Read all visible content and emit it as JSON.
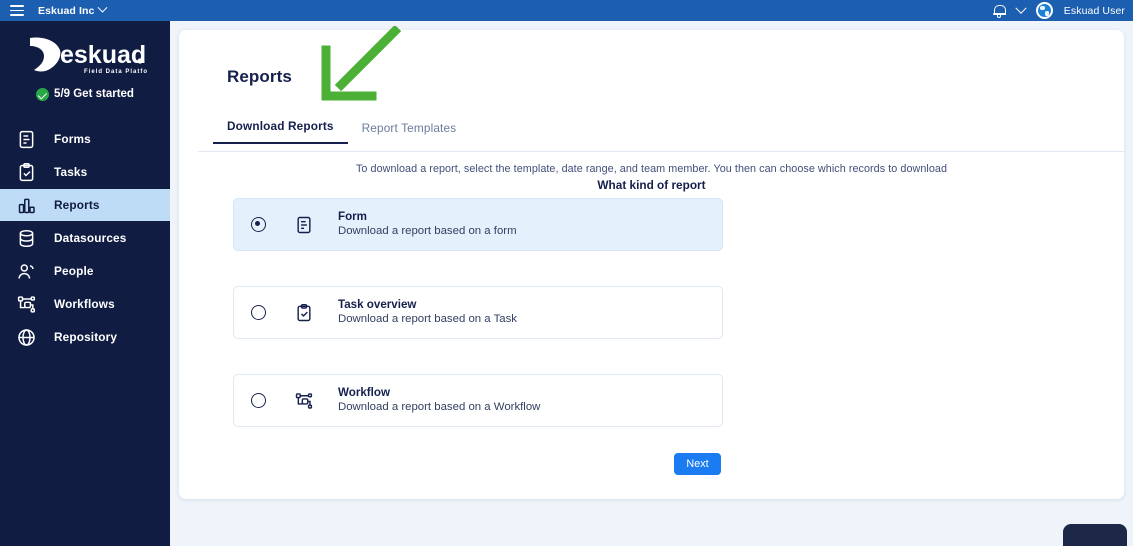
{
  "topbar": {
    "menu_icon": "hamburger-icon",
    "org_name": "Eskuad Inc",
    "org_chevron": "chevron-down-icon",
    "bell_icon": "bell-icon",
    "account_chevron": "chevron-down-icon",
    "avatar_icon": "globe-avatar-icon",
    "user_name": "Eskuad User",
    "bg_color": "#1c5eaf"
  },
  "sidebar": {
    "logo_text": "eskuad.",
    "logo_tagline": "Field Data Platform",
    "get_started": {
      "icon": "check-circle-icon",
      "label": "5/9 Get started",
      "icon_color": "#28a745"
    },
    "bg_color": "#101c42",
    "active_bg_color": "#bedcf6",
    "items": [
      {
        "label": "Forms",
        "icon": "form-document-icon",
        "active": false
      },
      {
        "label": "Tasks",
        "icon": "clipboard-check-icon",
        "active": false
      },
      {
        "label": "Reports",
        "icon": "bar-chart-icon",
        "active": true
      },
      {
        "label": "Datasources",
        "icon": "database-icon",
        "active": false
      },
      {
        "label": "People",
        "icon": "people-icon",
        "active": false
      },
      {
        "label": "Workflows",
        "icon": "workflow-nodes-icon",
        "active": false
      },
      {
        "label": "Repository",
        "icon": "globe-icon",
        "active": false
      }
    ]
  },
  "main": {
    "page_title": "Reports",
    "tabs": [
      {
        "label": "Download Reports",
        "active": true
      },
      {
        "label": "Report Templates",
        "active": false
      }
    ],
    "description": "To download a report, select the template, date range, and team member. You then can choose which records to download",
    "subheading": "What kind of report",
    "options": [
      {
        "title": "Form",
        "subtitle": "Download a report based on a form",
        "icon": "form-document-icon",
        "selected": true
      },
      {
        "title": "Task overview",
        "subtitle": "Download a report based on a Task",
        "icon": "clipboard-check-icon",
        "selected": false
      },
      {
        "title": "Workflow",
        "subtitle": "Download a report based on a Workflow",
        "icon": "workflow-nodes-icon",
        "selected": false
      }
    ],
    "next_button": "Next",
    "next_button_color": "#1a7cf0"
  },
  "annotation": {
    "arrow_icon": "arrow-down-left-icon",
    "color": "#4caf36"
  },
  "chat_widget": {
    "icon": "chat-bubble-icon"
  }
}
